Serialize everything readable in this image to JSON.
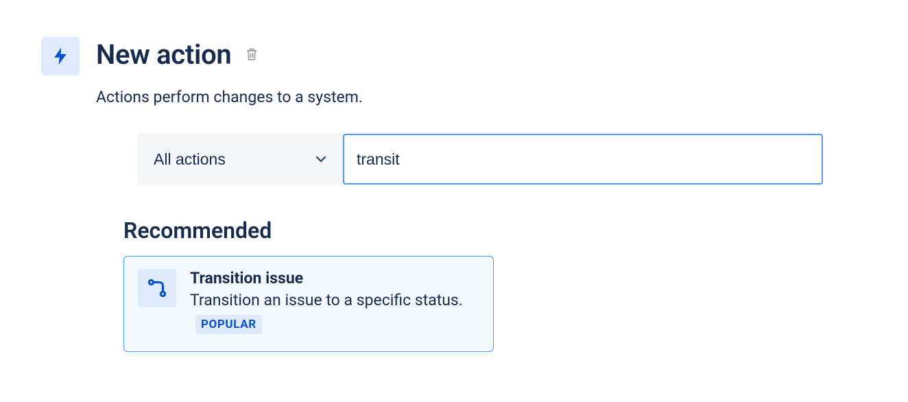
{
  "header": {
    "title": "New action",
    "description": "Actions perform changes to a system."
  },
  "filter": {
    "dropdown_label": "All actions",
    "search_value": "transit"
  },
  "section": {
    "title": "Recommended"
  },
  "card": {
    "title": "Transition issue",
    "description_part1": "Transition an issue to a specific status.",
    "badge": "POPULAR"
  }
}
